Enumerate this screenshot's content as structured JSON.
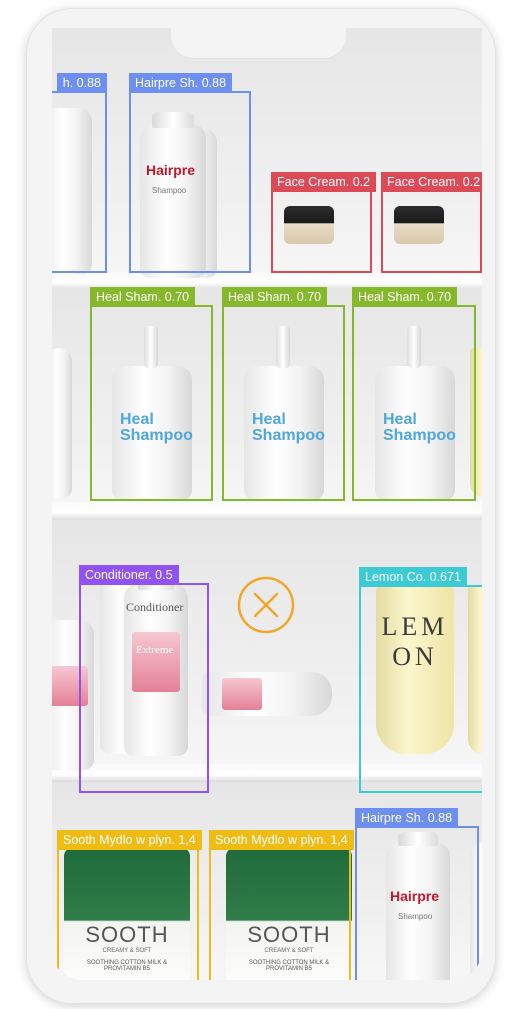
{
  "detections": [
    {
      "label": "h. 0.88",
      "color": "#6d8ff0"
    },
    {
      "label": "Hairpre Sh. 0.88",
      "color": "#6d8ff0"
    },
    {
      "label": "Face Cream. 0.2",
      "color": "#dc4a58"
    },
    {
      "label": "Face Cream. 0.2",
      "color": "#dc4a58"
    },
    {
      "label": "Heal Sham. 0.70",
      "color": "#86b82b"
    },
    {
      "label": "Heal Sham. 0.70",
      "color": "#86b82b"
    },
    {
      "label": "Heal Sham. 0.70",
      "color": "#86b82b"
    },
    {
      "label": "Conditioner. 0.5",
      "color": "#9052f0"
    },
    {
      "label": "Lemon Co. 0.671",
      "color": "#3ccad4"
    },
    {
      "label": "Hairpre Sh. 0.88",
      "color": "#6d8ff0"
    },
    {
      "label": "Sooth Mydlo w plyn. 1,4",
      "color": "#f0bc14"
    },
    {
      "label": "Sooth Mydlo w plyn. 1,4",
      "color": "#f0bc14"
    }
  ],
  "products": {
    "hairpre_brand": "Hairpre",
    "shampoo_word": "Shampoo",
    "heal_line1": "Heal",
    "heal_line2": "Shampoo",
    "conditioner_word": "Conditioner",
    "extreme_word": "Extreme",
    "lemon_line1": "LEM",
    "lemon_line2": "ON",
    "sooth_title": "SOOTH",
    "sooth_sub": "CREAMY & SOFT",
    "sooth_desc": "SOOTHING COTTON MILK & PROVITAMIN B5"
  },
  "not_recognized_icon": "circle-x-icon",
  "colors": {
    "not_recognized": "#f3a62a"
  }
}
